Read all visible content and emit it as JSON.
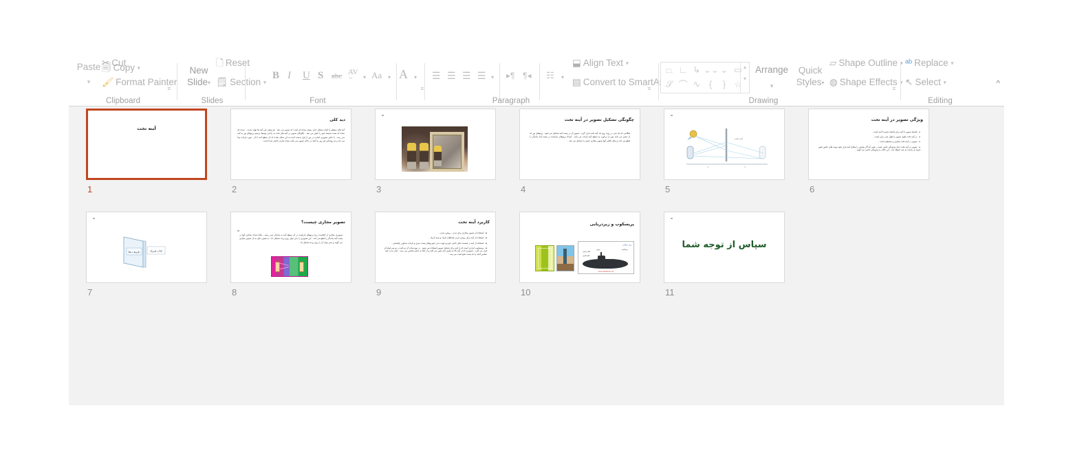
{
  "ribbon": {
    "groups": [
      {
        "label": "Clipboard"
      },
      {
        "label": "Slides"
      },
      {
        "label": "Font"
      },
      {
        "label": "Paragraph"
      },
      {
        "label": "Drawing"
      },
      {
        "label": "Editing"
      }
    ],
    "clipboard": {
      "paste_label": "Paste",
      "cut_label": "Cut",
      "copy_label": "Copy",
      "format_painter_label": "Format Painter",
      "group_label": "Clipboard"
    },
    "slides": {
      "new_slide_label_line1": "New",
      "new_slide_label_line2": "Slide",
      "reset_label": "Reset",
      "section_label": "Section",
      "group_label": "Slides"
    },
    "font": {
      "bold_label": "B",
      "italic_label": "I",
      "underline_label": "U",
      "shadow_label": "S",
      "strikethrough_label": "abc",
      "character_spacing_label": "AV",
      "change_case_label": "Aa",
      "font_color_label": "A",
      "group_label": "Font"
    },
    "paragraph": {
      "align_left_label": "align-left",
      "align_center_label": "align-center",
      "align_right_label": "align-right",
      "justify_label": "justify",
      "ltr_label": "ltr",
      "rtl_label": "rtl",
      "columns_label": "columns",
      "align_text_label": "Align Text",
      "convert_to_smartart_label": "Convert to SmartArt",
      "group_label": "Paragraph"
    },
    "drawing": {
      "arrange_label": "Arrange",
      "quick_styles_line1": "Quick",
      "quick_styles_line2": "Styles",
      "shape_outline_label": "Shape Outline",
      "shape_effects_label": "Shape Effects",
      "group_label": "Drawing",
      "shapes_row1": [
        "trapezoid",
        "corner",
        "bent-arrow",
        "chevron-down-left",
        "chevron-v",
        "rounded-rect"
      ],
      "shapes_row2": [
        "freeform",
        "arc",
        "curve",
        "left-brace",
        "right-brace",
        "star"
      ]
    },
    "editing": {
      "replace_label": "Replace",
      "select_label": "Select",
      "group_label": "Editing"
    },
    "collapse_label": "^"
  },
  "sorter": {
    "selected_slide": 1,
    "selection_color": "#c0451f",
    "background_color": "#f2f2f2",
    "slides": [
      {
        "number": "1",
        "title": "آینه تخت",
        "body": "",
        "bullets": []
      },
      {
        "number": "2",
        "title": "دید کلی",
        "body": "آینه های صیقلی یا لعاب شفاف ابزار بسیار ساده ای است که تصویر می دهد . هر وقتی این آینه ها تولید شدند ، عمده ای ساده که پشت شیشه خود را تابش می دهد . چگونگی تصویر در آینه های تخت به راحتی توسط ترسیم پرتوهای نور به آینه می رسد ، با تکثیر تصویری اشاره در نور از اول بدست آمده به این شکل ساده که آن سطح آینه با آن ، مورد بازتاب پیدا می کند و به روشنایی هر روز به آنچه در داخل تصویر می باشد ساده سازی حاصل شده است .",
        "bullets": []
      },
      {
        "number": "3",
        "title": "",
        "body": "",
        "bullets": []
      },
      {
        "number": "4",
        "title": "چگونگی تشکیل تصویر در آینه تخت",
        "body": "هنگامی که یک شی در روبه روی یک آینه تخت قرار گیرد ، تصویر آن در پشت آینه تشکیل می شود . پرتوهای نور که از جسم می تابند پس از برخورد به سطح آینه بازتاب می یابند . امتداد پرتوهای بازتابیده در پشت آینه یکدیگر را قطع می کنند و محل تلاقی آنها تصویر مجازی جسم را تشکیل می دهد .",
        "bullets": []
      },
      {
        "number": "5",
        "title": "",
        "body": "",
        "bullets": []
      },
      {
        "number": "6",
        "title": "ویژگی تصویر در آینه تخت",
        "body": "",
        "bullets": [
          "فاصله تصویر تا آینه برابر فاصله جسم تا آینه است .",
          "در آینه تخت طول تصویر با طول شی برابر است .",
          "تصویر در آینه تخت مجازی و مستقیم است .",
          "تصویر در آینه تخت دچار وارونگی جانبی است ، یعنی که اگر طرفی را مقابل آینه قرار دهید نوبت های عکس تغییر قرینه از راست به چپ خواهد شد . این حالت را وارونگی جانبی می گویند ."
        ]
      },
      {
        "number": "7",
        "title": "",
        "body": "",
        "bullets": [],
        "diagram_labels": [
          "آینه تخت",
          "کتاب فیزیک"
        ]
      },
      {
        "number": "8",
        "title": "تصویر مجازی چیست؟",
        "body": "تصویری مجازی از آنجاست زیرا پرتوهای بازتابیده در آن سطح آینه به یکدیگر نمی رسند ، بلکه امتداد مجازی آنها در پشت آینه یکدیگر را قطع می کنند . این تصویری را نمی توان روی پرده تشکیل داد ، به همین دلیل به آن تصویر مجازی می گویند و نمی توان آن را روی پرده تشکیل داد .",
        "bullets": []
      },
      {
        "number": "9",
        "title": "کاربرد آینه تخت",
        "body": "",
        "bullets": [
          "استفاده از تصویر مجازی برای دیدن ، روشن شدن .",
          "استفاده از آینه برای روشن کردن فضاهای تاریک و نیمه تاریک .",
          "استفاده از آینه در قسمت های جانبی خودرو جهت دیدن خودروهای پشت سری و بازتاب تصاویر راهنمایی .",
          "پریسکوپ ابزاری است که از آینه برای تشکیل تصویر استفاده می شود . در نوع ساده آن دو آینه در دو سر لوله ای قرار می گیرد ، تصویری که از آینه بالا به طرف آینه پایین می افتد و از آنجا به چشم شخص می رسد ، بنابر دیدن خود شخص آنچه را که پشت مانع است می بیند ."
        ]
      },
      {
        "number": "10",
        "title": "پریسکوپ و زیردریایی",
        "body": "",
        "bullets": [],
        "image_labels": {
          "submarine_title": "زیر دریایی",
          "submarine_site": "www.rasekhoon.net",
          "annotations": [
            "اتاق فرمان",
            "پریسکوپ",
            "موتور",
            "اتاق کنترل"
          ]
        }
      },
      {
        "number": "11",
        "title": "",
        "thanks_text": "سپاس از توجه شما",
        "thanks_color": "#1f5c29",
        "body": "",
        "bullets": []
      }
    ]
  }
}
